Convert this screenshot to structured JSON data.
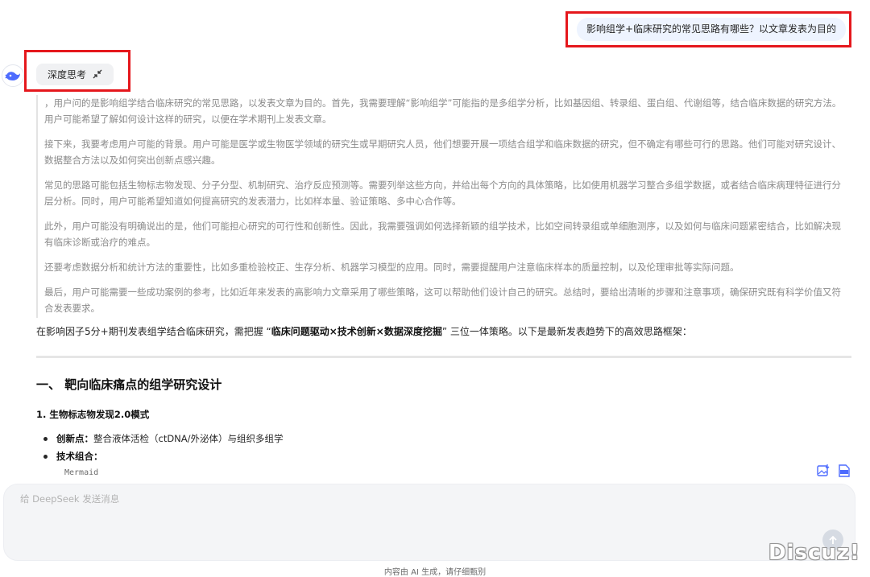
{
  "user_message": "影响组学+临床研究的常见思路有哪些？以文章发表为目的",
  "deep_think": {
    "label": "深度思考"
  },
  "reasoning": [
    "，用户问的是影响组学结合临床研究的常见思路，以发表文章为目的。首先，我需要理解“影响组学”可能指的是多组学分析，比如基因组、转录组、蛋白组、代谢组等，结合临床数据的研究方法。用户可能希望了解如何设计这样的研究，以便在学术期刊上发表文章。",
    "接下来，我要考虑用户可能的背景。用户可能是医学或生物医学领域的研究生或早期研究人员，他们想要开展一项结合组学和临床数据的研究，但不确定有哪些可行的思路。他们可能对研究设计、数据整合方法以及如何突出创新点感兴趣。",
    "常见的思路可能包括生物标志物发现、分子分型、机制研究、治疗反应预测等。需要列举这些方向，并给出每个方向的具体策略，比如使用机器学习整合多组学数据，或者结合临床病理特征进行分层分析。同时，用户可能希望知道如何提高研究的发表潜力，比如样本量、验证策略、多中心合作等。",
    "此外，用户可能没有明确说出的是，他们可能担心研究的可行性和创新性。因此，我需要强调如何选择新颖的组学技术，比如空间转录组或单细胞测序，以及如何与临床问题紧密结合，比如解决现有临床诊断或治疗的难点。",
    "还要考虑数据分析和统计方法的重要性，比如多重检验校正、生存分析、机器学习模型的应用。同时，需要提醒用户注意临床样本的质量控制，以及伦理审批等实际问题。",
    "最后，用户可能需要一些成功案例的参考，比如近年来发表的高影响力文章采用了哪些策略，这可以帮助他们设计自己的研究。总结时，要给出清晰的步骤和注意事项，确保研究既有科学价值又符合发表要求。"
  ],
  "answer": {
    "intro_before": "在影响因子5分+期刊发表组学结合临床研究，需把握 “",
    "intro_bold": "临床问题驱动×技术创新×数据深度挖掘",
    "intro_after": "” 三位一体策略。以下是最新发表趋势下的高效思路框架：",
    "section_title": "一、 靶向临床痛点的组学研究设计",
    "subsection_title": "1. 生物标志物发现2.0模式",
    "bullets": [
      {
        "label": "创新点：",
        "text": "整合液体活检（ctDNA/外泌体）与组织多组学"
      },
      {
        "label": "技术组合：",
        "text": ""
      }
    ],
    "code_lang": "Mermaid"
  },
  "input": {
    "placeholder": "给 DeepSeek 发送消息"
  },
  "footer_note": "内容由 AI 生成，请仔细甄别",
  "watermark": "Discuz!",
  "colors": {
    "highlight": "#e5171c",
    "user_bubble": "#eef4ff",
    "brand_blue": "#4d6bfe",
    "reasoning_text": "#8b8b8b"
  }
}
